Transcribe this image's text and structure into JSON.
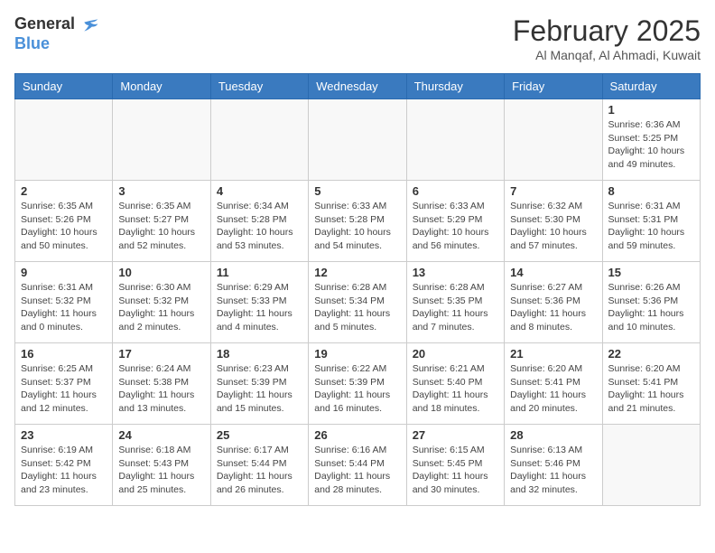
{
  "header": {
    "logo_general": "General",
    "logo_blue": "Blue",
    "month_year": "February 2025",
    "location": "Al Manqaf, Al Ahmadi, Kuwait"
  },
  "days_of_week": [
    "Sunday",
    "Monday",
    "Tuesday",
    "Wednesday",
    "Thursday",
    "Friday",
    "Saturday"
  ],
  "weeks": [
    [
      {
        "day": "",
        "info": ""
      },
      {
        "day": "",
        "info": ""
      },
      {
        "day": "",
        "info": ""
      },
      {
        "day": "",
        "info": ""
      },
      {
        "day": "",
        "info": ""
      },
      {
        "day": "",
        "info": ""
      },
      {
        "day": "1",
        "info": "Sunrise: 6:36 AM\nSunset: 5:25 PM\nDaylight: 10 hours and 49 minutes."
      }
    ],
    [
      {
        "day": "2",
        "info": "Sunrise: 6:35 AM\nSunset: 5:26 PM\nDaylight: 10 hours and 50 minutes."
      },
      {
        "day": "3",
        "info": "Sunrise: 6:35 AM\nSunset: 5:27 PM\nDaylight: 10 hours and 52 minutes."
      },
      {
        "day": "4",
        "info": "Sunrise: 6:34 AM\nSunset: 5:28 PM\nDaylight: 10 hours and 53 minutes."
      },
      {
        "day": "5",
        "info": "Sunrise: 6:33 AM\nSunset: 5:28 PM\nDaylight: 10 hours and 54 minutes."
      },
      {
        "day": "6",
        "info": "Sunrise: 6:33 AM\nSunset: 5:29 PM\nDaylight: 10 hours and 56 minutes."
      },
      {
        "day": "7",
        "info": "Sunrise: 6:32 AM\nSunset: 5:30 PM\nDaylight: 10 hours and 57 minutes."
      },
      {
        "day": "8",
        "info": "Sunrise: 6:31 AM\nSunset: 5:31 PM\nDaylight: 10 hours and 59 minutes."
      }
    ],
    [
      {
        "day": "9",
        "info": "Sunrise: 6:31 AM\nSunset: 5:32 PM\nDaylight: 11 hours and 0 minutes."
      },
      {
        "day": "10",
        "info": "Sunrise: 6:30 AM\nSunset: 5:32 PM\nDaylight: 11 hours and 2 minutes."
      },
      {
        "day": "11",
        "info": "Sunrise: 6:29 AM\nSunset: 5:33 PM\nDaylight: 11 hours and 4 minutes."
      },
      {
        "day": "12",
        "info": "Sunrise: 6:28 AM\nSunset: 5:34 PM\nDaylight: 11 hours and 5 minutes."
      },
      {
        "day": "13",
        "info": "Sunrise: 6:28 AM\nSunset: 5:35 PM\nDaylight: 11 hours and 7 minutes."
      },
      {
        "day": "14",
        "info": "Sunrise: 6:27 AM\nSunset: 5:36 PM\nDaylight: 11 hours and 8 minutes."
      },
      {
        "day": "15",
        "info": "Sunrise: 6:26 AM\nSunset: 5:36 PM\nDaylight: 11 hours and 10 minutes."
      }
    ],
    [
      {
        "day": "16",
        "info": "Sunrise: 6:25 AM\nSunset: 5:37 PM\nDaylight: 11 hours and 12 minutes."
      },
      {
        "day": "17",
        "info": "Sunrise: 6:24 AM\nSunset: 5:38 PM\nDaylight: 11 hours and 13 minutes."
      },
      {
        "day": "18",
        "info": "Sunrise: 6:23 AM\nSunset: 5:39 PM\nDaylight: 11 hours and 15 minutes."
      },
      {
        "day": "19",
        "info": "Sunrise: 6:22 AM\nSunset: 5:39 PM\nDaylight: 11 hours and 16 minutes."
      },
      {
        "day": "20",
        "info": "Sunrise: 6:21 AM\nSunset: 5:40 PM\nDaylight: 11 hours and 18 minutes."
      },
      {
        "day": "21",
        "info": "Sunrise: 6:20 AM\nSunset: 5:41 PM\nDaylight: 11 hours and 20 minutes."
      },
      {
        "day": "22",
        "info": "Sunrise: 6:20 AM\nSunset: 5:41 PM\nDaylight: 11 hours and 21 minutes."
      }
    ],
    [
      {
        "day": "23",
        "info": "Sunrise: 6:19 AM\nSunset: 5:42 PM\nDaylight: 11 hours and 23 minutes."
      },
      {
        "day": "24",
        "info": "Sunrise: 6:18 AM\nSunset: 5:43 PM\nDaylight: 11 hours and 25 minutes."
      },
      {
        "day": "25",
        "info": "Sunrise: 6:17 AM\nSunset: 5:44 PM\nDaylight: 11 hours and 26 minutes."
      },
      {
        "day": "26",
        "info": "Sunrise: 6:16 AM\nSunset: 5:44 PM\nDaylight: 11 hours and 28 minutes."
      },
      {
        "day": "27",
        "info": "Sunrise: 6:15 AM\nSunset: 5:45 PM\nDaylight: 11 hours and 30 minutes."
      },
      {
        "day": "28",
        "info": "Sunrise: 6:13 AM\nSunset: 5:46 PM\nDaylight: 11 hours and 32 minutes."
      },
      {
        "day": "",
        "info": ""
      }
    ]
  ]
}
